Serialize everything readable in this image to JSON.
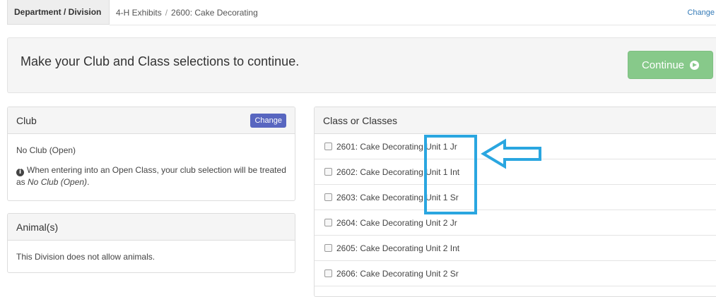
{
  "breadcrumb": {
    "label": "Department / Division",
    "department": "4-H Exhibits",
    "separator": "/",
    "division": "2600: Cake Decorating",
    "change_link": "Change"
  },
  "prompt": {
    "message": "Make your Club and Class selections to continue.",
    "continue_label": "Continue"
  },
  "club_panel": {
    "title": "Club",
    "change_label": "Change",
    "selected": "No Club (Open)",
    "note_prefix": "When entering into an Open Class, your club selection will be treated as ",
    "note_emphasis": "No Club (Open)",
    "note_suffix": "."
  },
  "animals_panel": {
    "title": "Animal(s)",
    "message": "This Division does not allow animals."
  },
  "classes_panel": {
    "title": "Class or Classes",
    "items": [
      {
        "label": "2601: Cake Decorating Unit 1 Jr",
        "checked": false
      },
      {
        "label": "2602: Cake Decorating Unit 1 Int",
        "checked": false
      },
      {
        "label": "2603: Cake Decorating Unit 1 Sr",
        "checked": false
      },
      {
        "label": "2604: Cake Decorating Unit 2 Jr",
        "checked": false
      },
      {
        "label": "2605: Cake Decorating Unit 2 Int",
        "checked": false
      },
      {
        "label": "2606: Cake Decorating Unit 2 Sr",
        "checked": false
      }
    ]
  },
  "colors": {
    "continue_button": "#87c98a",
    "change_button": "#5866c0",
    "annotation": "#2aa6e0",
    "link": "#337ab7"
  },
  "icons": {
    "continue": "arrow-circle-right-icon",
    "info": "info-circle-icon",
    "annotation": "left-arrow-icon"
  }
}
